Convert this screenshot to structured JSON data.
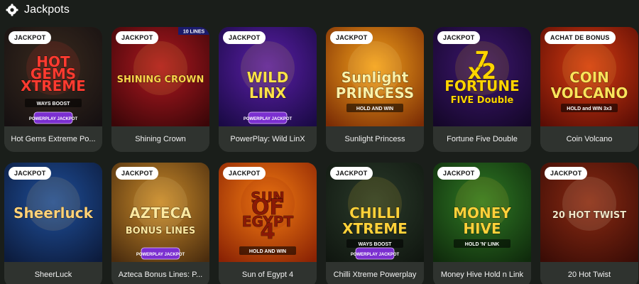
{
  "section": {
    "title": "Jackpots",
    "icon": "slot-gear-icon"
  },
  "games": [
    {
      "name": "Hot Gems Extreme Po...",
      "badge": "JACKPOT",
      "logo_lines": [
        "HOT",
        "GEMS",
        "XTREME"
      ],
      "sub": "WAYS BOOST",
      "footer": "POWERPLAY JACKPOT",
      "bg": [
        "#3a2a1e",
        "#151011"
      ],
      "accent": "#ff3b30"
    },
    {
      "name": "Shining Crown",
      "badge": "JACKPOT",
      "logo_lines": [
        "SHINING CROWN"
      ],
      "top_tag": "10 LINES",
      "bg": [
        "#b01820",
        "#3a0608"
      ],
      "accent": "#ffd54a"
    },
    {
      "name": "PowerPlay: Wild LinX",
      "badge": "JACKPOT",
      "logo_lines": [
        "WILD",
        "LINX"
      ],
      "footer": "POWERPLAY JACKPOT",
      "bg": [
        "#5b1fa8",
        "#1a0a45"
      ],
      "accent": "#ffe14a"
    },
    {
      "name": "Sunlight Princess",
      "badge": "JACKPOT",
      "logo_lines": [
        "Sunlight",
        "PRINCESS"
      ],
      "sub": "HOLD AND WIN",
      "bg": [
        "#f6a21a",
        "#7a2c05"
      ],
      "accent": "#fff2a8"
    },
    {
      "name": "Fortune Five Double",
      "badge": "JACKPOT",
      "logo_lines": [
        "7",
        "x2",
        "FORTUNE",
        "FIVE Double"
      ],
      "bg": [
        "#3d1670",
        "#140728"
      ],
      "accent": "#ffd400"
    },
    {
      "name": "Coin Volcano",
      "badge": "ACHAT DE BONUS",
      "logo_lines": [
        "COIN",
        "VOLCANO"
      ],
      "sub": "HOLD and WIN 3x3",
      "bg": [
        "#d63a10",
        "#5a0d05"
      ],
      "accent": "#ffe35a"
    },
    {
      "name": "SheerLuck",
      "badge": "JACKPOT",
      "logo_lines": [
        "Sheerluck"
      ],
      "bg": [
        "#1f4f9a",
        "#0c1b3c"
      ],
      "accent": "#ffd27a"
    },
    {
      "name": "Azteca Bonus Lines: P...",
      "badge": "JACKPOT",
      "logo_lines": [
        "AZTECA",
        "BONUS LINES"
      ],
      "footer": "POWERPLAY JACKPOT",
      "bg": [
        "#c98a2a",
        "#4a2c0e"
      ],
      "accent": "#ffe9a0"
    },
    {
      "name": "Sun of Egypt 4",
      "badge": "JACKPOT",
      "logo_lines": [
        "SUN",
        "OF",
        "EGYPT",
        "4"
      ],
      "sub": "HOLD AND WIN",
      "bg": [
        "#f57d12",
        "#8a2204"
      ],
      "accent": "#8a1a06"
    },
    {
      "name": "Chilli Xtreme Powerplay",
      "badge": "JACKPOT",
      "logo_lines": [
        "CHILLI",
        "XTREME"
      ],
      "sub": "WAYS BOOST",
      "footer": "POWERPLAY JACKPOT",
      "bg": [
        "#2a3b2a",
        "#101610"
      ],
      "accent": "#ffd23a"
    },
    {
      "name": "Money Hive Hold n Link",
      "badge": "JACKPOT",
      "logo_lines": [
        "MONEY",
        "HIVE"
      ],
      "sub": "HOLD 'N' LINK",
      "bg": [
        "#2f7a24",
        "#0f2a0c"
      ],
      "accent": "#ffd23a"
    },
    {
      "name": "20 Hot Twist",
      "badge": "JACKPOT",
      "logo_lines": [
        "20 HOT TWIST"
      ],
      "bg": [
        "#8a2a12",
        "#3a0c06"
      ],
      "accent": "#f4e6c8"
    }
  ]
}
